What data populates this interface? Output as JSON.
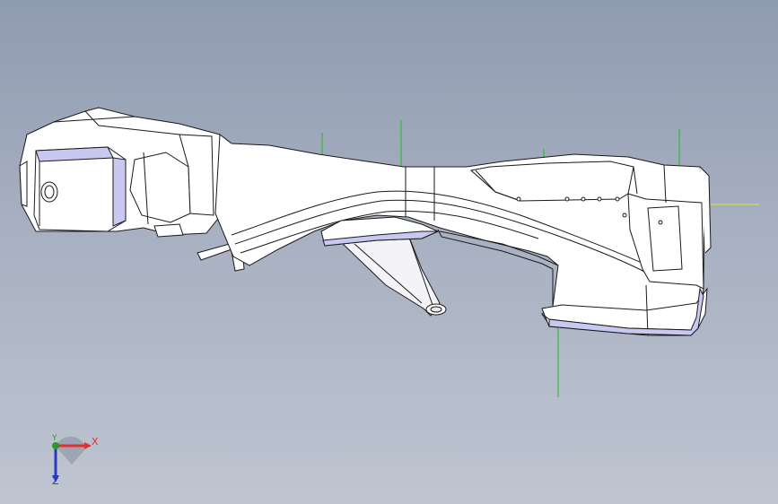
{
  "viewport": {
    "background_top": "#8f9bb0",
    "background_bottom": "#bfc5d1"
  },
  "triad": {
    "x_label": "X",
    "y_label": "Y",
    "z_label": "Z",
    "x_color": "#e03030",
    "y_color": "#2a9a2a",
    "z_color": "#2a3ac0"
  },
  "model": {
    "edge_color": "#1a1a1a",
    "face_color": "#ffffff",
    "highlight_face_color": "#c8c8f0",
    "reference_line_colors": [
      "#22bb22",
      "#e6e62a"
    ]
  }
}
